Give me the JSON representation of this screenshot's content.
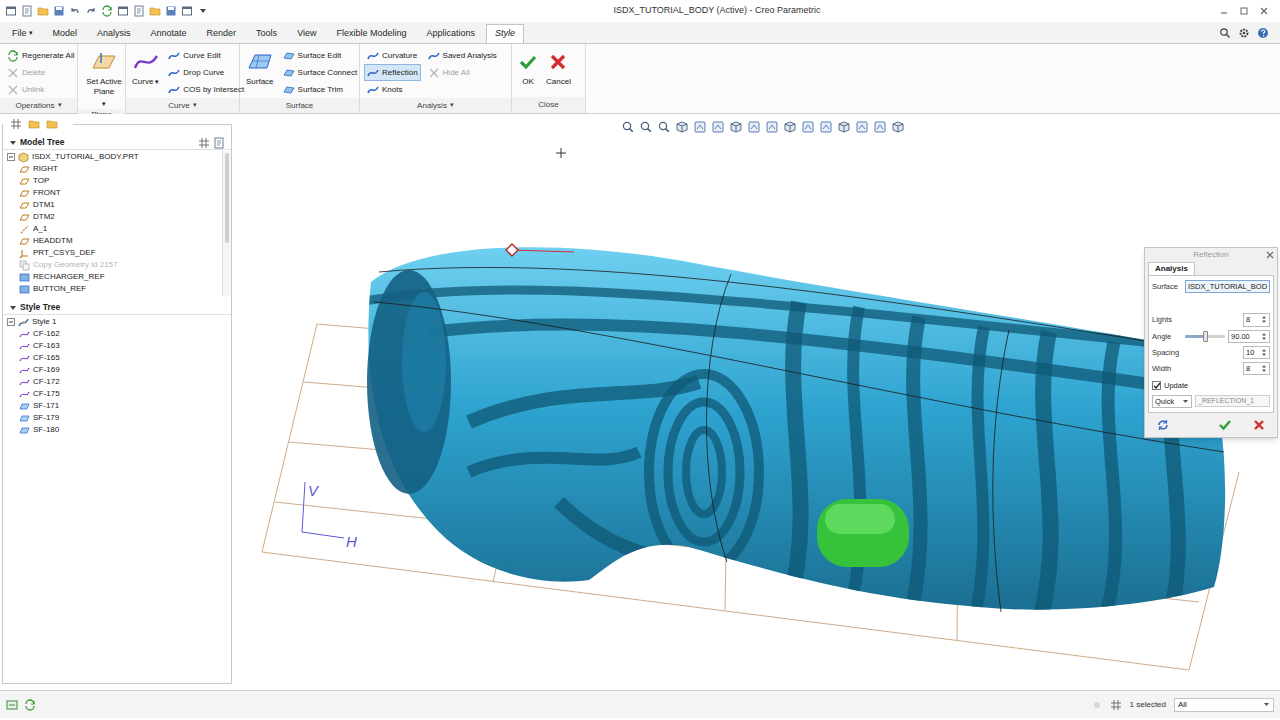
{
  "window": {
    "title": "ISDX_TUTORIAL_BODY (Active) - Creo Parametric"
  },
  "ribbon_tabs": [
    {
      "label": "File",
      "arrow": "▾",
      "selected": false
    },
    {
      "label": "Model",
      "selected": false
    },
    {
      "label": "Analysis",
      "selected": false
    },
    {
      "label": "Annotate",
      "selected": false
    },
    {
      "label": "Render",
      "selected": false
    },
    {
      "label": "Tools",
      "selected": false
    },
    {
      "label": "View",
      "selected": false
    },
    {
      "label": "Flexible Modeling",
      "selected": false
    },
    {
      "label": "Applications",
      "selected": false
    },
    {
      "label": "Style",
      "selected": true
    }
  ],
  "ribbon_groups": [
    {
      "label": "Operations",
      "arrow": "▾",
      "items": [
        {
          "label": "Regenerate All",
          "kind": "small",
          "disabled": false,
          "selected": false
        },
        {
          "label": "Delete",
          "kind": "small",
          "disabled": true,
          "selected": false
        },
        {
          "label": "Unlink",
          "kind": "small",
          "disabled": true,
          "selected": false
        }
      ]
    },
    {
      "label": "Plane",
      "items": [
        {
          "label": "Set Active Plane",
          "arrow": "▾",
          "kind": "large",
          "disabled": false,
          "selected": false
        }
      ]
    },
    {
      "label": "Curve",
      "arrow": "▾",
      "items": [
        {
          "label": "Curve",
          "arrow": "▾",
          "kind": "large",
          "disabled": false,
          "selected": false
        },
        {
          "label": "Curve Edit",
          "kind": "small",
          "disabled": false,
          "selected": false
        },
        {
          "label": "Drop Curve",
          "kind": "small",
          "disabled": false,
          "selected": false
        },
        {
          "label": "COS by Intersect",
          "kind": "small",
          "disabled": false,
          "selected": false
        }
      ]
    },
    {
      "label": "Surface",
      "items": [
        {
          "label": "Surface",
          "kind": "large",
          "disabled": false,
          "selected": false
        },
        {
          "label": "Surface Edit",
          "kind": "small",
          "disabled": false,
          "selected": false
        },
        {
          "label": "Surface Connect",
          "kind": "small",
          "disabled": false,
          "selected": false
        },
        {
          "label": "Surface Trim",
          "kind": "small",
          "disabled": false,
          "selected": false
        }
      ]
    },
    {
      "label": "Analysis",
      "arrow": "▾",
      "items": [
        {
          "label": "Curvature",
          "kind": "small",
          "disabled": false,
          "selected": false
        },
        {
          "label": "Reflection",
          "kind": "small",
          "disabled": false,
          "selected": true
        },
        {
          "label": "Knots",
          "kind": "small",
          "disabled": false,
          "selected": false
        },
        {
          "label": "Saved Analysis",
          "kind": "small",
          "disabled": false,
          "selected": false
        },
        {
          "label": "Hide All",
          "kind": "small",
          "disabled": true,
          "selected": false
        }
      ]
    },
    {
      "label": "Close",
      "items": [
        {
          "label": "OK",
          "kind": "confirm",
          "disabled": false,
          "selected": false
        },
        {
          "label": "Cancel",
          "kind": "cancel",
          "disabled": false,
          "selected": false
        }
      ]
    }
  ],
  "model_tree": {
    "title": "Model Tree",
    "items": [
      {
        "label": "ISDX_TUTORIAL_BODY.PRT",
        "kind": "part",
        "disabled": false
      },
      {
        "label": "RIGHT",
        "kind": "plane",
        "disabled": false
      },
      {
        "label": "TOP",
        "kind": "plane",
        "disabled": false
      },
      {
        "label": "FRONT",
        "kind": "plane",
        "disabled": false
      },
      {
        "label": "DTM1",
        "kind": "plane",
        "disabled": false
      },
      {
        "label": "DTM2",
        "kind": "plane",
        "disabled": false
      },
      {
        "label": "A_1",
        "kind": "axis",
        "disabled": false
      },
      {
        "label": "HEADDTM",
        "kind": "plane",
        "disabled": false
      },
      {
        "label": "PRT_CSYS_DEF",
        "kind": "csys",
        "disabled": false
      },
      {
        "label": "Copy Geometry id 2157",
        "kind": "copy",
        "disabled": true
      },
      {
        "label": "RECHARGER_REF",
        "kind": "feature",
        "disabled": false
      },
      {
        "label": "BUTTON_REF",
        "kind": "feature",
        "disabled": false
      }
    ]
  },
  "style_tree": {
    "title": "Style Tree",
    "items": [
      {
        "label": "Style 1",
        "kind": "style"
      },
      {
        "label": "CF-162",
        "kind": "curve"
      },
      {
        "label": "CF-163",
        "kind": "curve"
      },
      {
        "label": "CF-165",
        "kind": "curve"
      },
      {
        "label": "CF-169",
        "kind": "curve"
      },
      {
        "label": "CF-172",
        "kind": "curve"
      },
      {
        "label": "CF-175",
        "kind": "curve"
      },
      {
        "label": "SF-171",
        "kind": "surface"
      },
      {
        "label": "SF-179",
        "kind": "surface"
      },
      {
        "label": "SF-180",
        "kind": "surface"
      }
    ]
  },
  "viewport": {
    "axis_labels": [
      "V",
      "H"
    ]
  },
  "reflection_dialog": {
    "title": "Reflection",
    "tab": "Analysis",
    "surface": {
      "label": "Surface",
      "value": "ISDX_TUTORIAL_BOD"
    },
    "lights": {
      "label": "Lights",
      "value": "8"
    },
    "angle": {
      "label": "Angle",
      "value": "90.00",
      "level": 0.5
    },
    "spacing": {
      "label": "Spacing",
      "value": "10"
    },
    "width": {
      "label": "Width",
      "value": "8"
    },
    "update": {
      "label": "Update",
      "checked": true
    },
    "mode": {
      "value": "Quick"
    },
    "name": {
      "value": "_REFLECTION_1"
    }
  },
  "status_bar": {
    "selection": "1 selected",
    "filter": "All"
  }
}
